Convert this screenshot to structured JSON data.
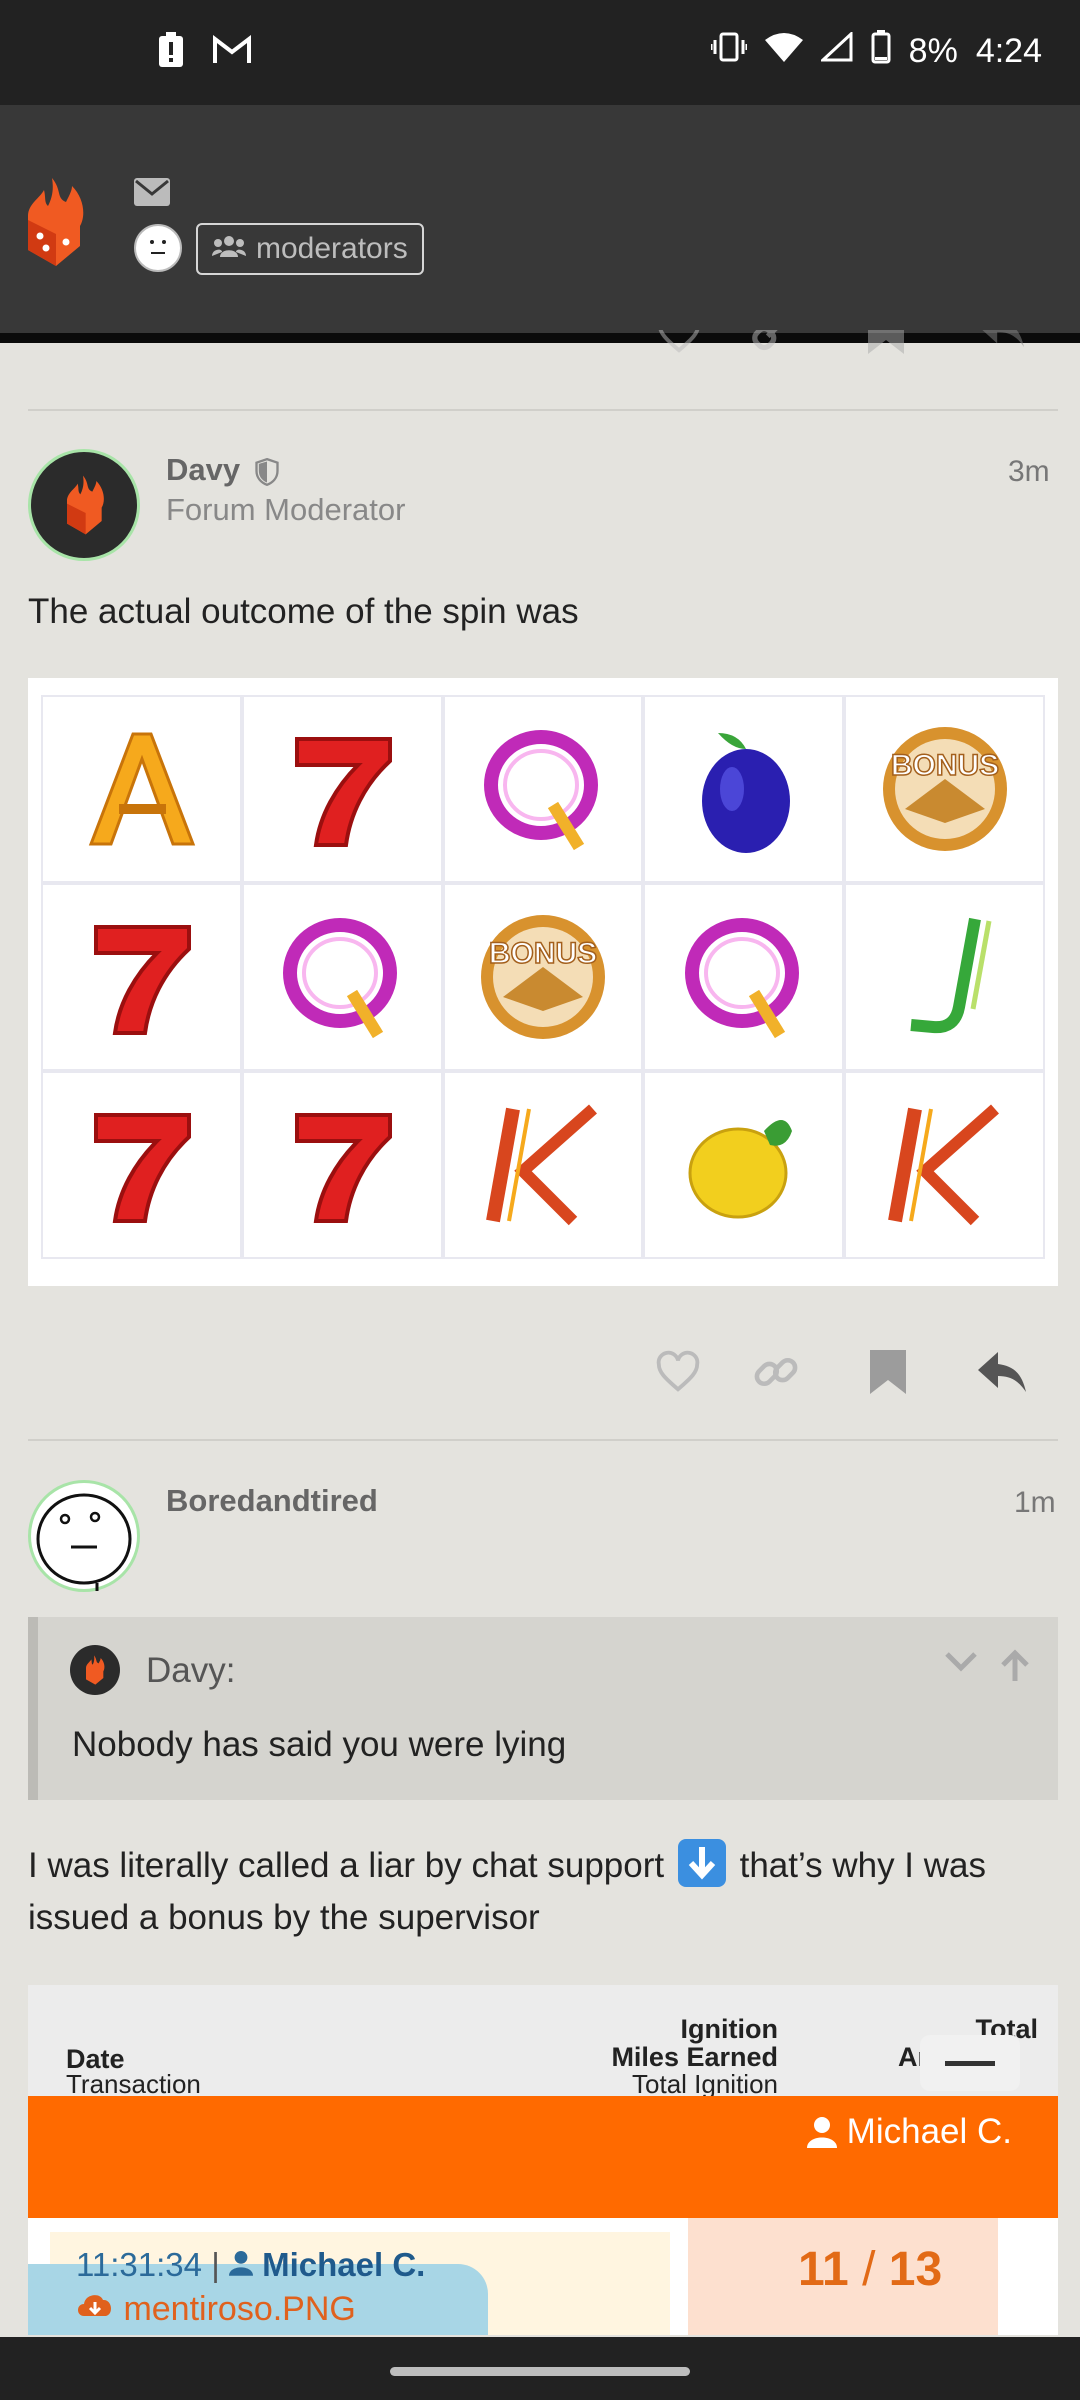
{
  "status_bar": {
    "battery": "8%",
    "time": "4:24",
    "icons": [
      "alert-battery-icon",
      "gmail-icon",
      "vibrate-icon",
      "wifi-icon",
      "signal-icon",
      "battery-icon"
    ]
  },
  "header": {
    "group_label": "moderators"
  },
  "post1": {
    "username": "Davy",
    "user_title": "Forum Moderator",
    "time": "3m",
    "text": "The actual outcome of the spin was",
    "slots": [
      [
        "A",
        "7",
        "Q",
        "plum",
        "BONUS"
      ],
      [
        "7",
        "Q",
        "BONUS",
        "Q",
        "J"
      ],
      [
        "7",
        "7",
        "K",
        "lemon",
        "K"
      ]
    ]
  },
  "post2": {
    "username": "Boredandtired",
    "time": "1m",
    "quote": {
      "author": "Davy:",
      "text": "Nobody has said you were lying"
    },
    "text_part1": "I was literally called a liar by chat support",
    "text_part2": "that’s why I was issued a bonus by the supervisor",
    "table": {
      "col_date": "Date",
      "col_date_sub": "Transaction",
      "col_miles_1": "Ignition",
      "col_miles_2": "Miles Earned",
      "col_miles_sub": "Total Ignition",
      "col_total_1": "Total",
      "col_total_2": "Am",
      "agent": "Michael C.",
      "chat_time": "11:31:34",
      "chat_agent": "Michael C.",
      "file": "mentiroso.PNG",
      "counter_current": "11",
      "counter_sep": "/",
      "counter_total": "13"
    }
  }
}
